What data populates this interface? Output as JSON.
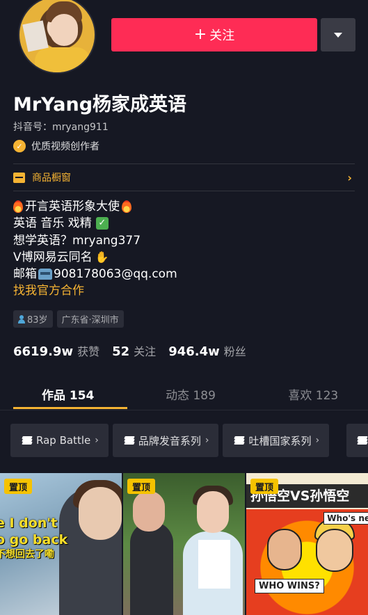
{
  "header": {
    "follow_label": "+ 关注",
    "follow_plus": "+",
    "follow_text": "关注"
  },
  "profile": {
    "nickname": "MrYang杨家成英语",
    "douyin_id": "抖音号：mryang911",
    "badge": "优质视频创作者",
    "shop": "商品橱窗"
  },
  "bio": {
    "line1": "开言英语形象大使",
    "line2": "英语 音乐 戏精",
    "line3": "想学英语？mryang377",
    "line4": "V博网易云同名",
    "line5_prefix": "邮箱",
    "line5_email": "908178063@qq.com",
    "line6": "找我官方合作"
  },
  "tags": {
    "age": "83岁",
    "location": "广东省·深圳市"
  },
  "stats": [
    {
      "num": "6619.9w",
      "label": "获赞"
    },
    {
      "num": "52",
      "label": "关注"
    },
    {
      "num": "946.4w",
      "label": "粉丝"
    }
  ],
  "tabs": [
    {
      "label": "作品 154"
    },
    {
      "label": "动态 189"
    },
    {
      "label": "喜欢 123"
    }
  ],
  "playlists": [
    {
      "label": "Rap Battle"
    },
    {
      "label": "品牌发音系列"
    },
    {
      "label": "吐槽国家系列"
    }
  ],
  "videos": [
    {
      "pin": "置顶",
      "caption1": "e I don't",
      "caption2": "o go back",
      "caption3": "不想回去了嘞"
    },
    {
      "pin": "置顶"
    },
    {
      "pin": "置顶",
      "title": "孙悟空VS孙悟空",
      "bubble1": "Who's ne",
      "bubble2": "WHO WINS?"
    }
  ],
  "colors": {
    "background": "#161823",
    "follow": "#fe2c55",
    "accent": "#f5b333",
    "pin": "#f5c200"
  }
}
